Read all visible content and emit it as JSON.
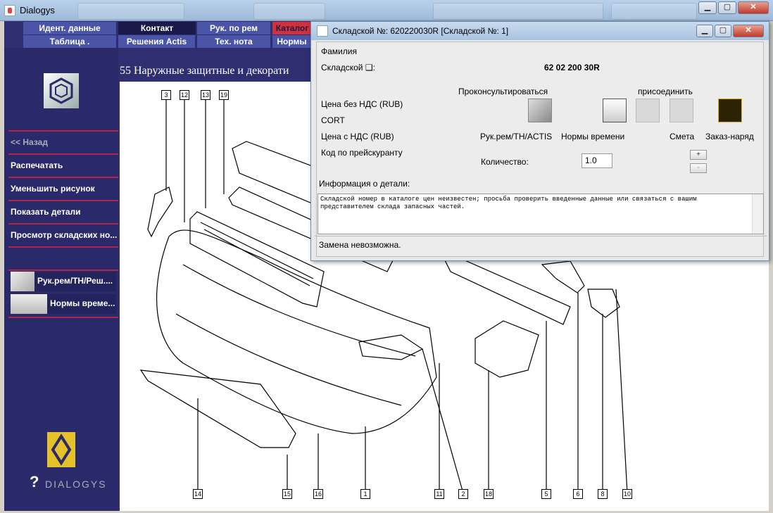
{
  "main_window": {
    "title": "Dialogys",
    "minimize": "▁",
    "maximize": "▢",
    "close": "✕"
  },
  "nav": {
    "row1": [
      "Идент. данные",
      "Контакт",
      "Рук. по рем",
      "Каталог"
    ],
    "row2": [
      "Таблица .",
      "Решения Actis",
      "Тех. нота",
      "Нормы"
    ]
  },
  "sidebar": {
    "back": "<< Назад",
    "items": [
      "Распечатать",
      "Уменьшить рисунок",
      "Показать детали",
      "Просмотр складских но..."
    ],
    "buttons": [
      "Рук.рем/ТН/Реш....",
      "Нормы време..."
    ],
    "logo_text": "DIALOGYS"
  },
  "content": {
    "title": "55 Наружные защитные и декорати"
  },
  "diagram": {
    "callouts_top": [
      "3",
      "12",
      "13",
      "19"
    ],
    "callouts_bottom": [
      "14",
      "15",
      "16",
      "1",
      "11",
      "2",
      "18",
      "5",
      "6",
      "8",
      "10"
    ]
  },
  "dialog": {
    "title": "Складской №: 620220030R [Складской №: 1]",
    "familiya": "Фамилия",
    "skladskoy_label": "Складской ❑:",
    "skladskoy_value": "62 02 200 30R",
    "price_no_vat": "Цена без НДС (RUB)",
    "cort": "CORT",
    "price_vat": "Цена с НДС (RUB)",
    "price_code": "Код по прейскуранту",
    "consult": "Проконсультироваться",
    "attach": "присоединить",
    "repair_label": "Рук.рем/ТН/ACTIS",
    "norms_label": "Нормы времени",
    "estimate_label": "Смета",
    "order_label": "Заказ-наряд",
    "qty_label": "Количество:",
    "qty_value": "1.0",
    "plus": "+",
    "minus": "-",
    "info_label": "Информация о детали:",
    "info_text": "Складской номер в каталоге цен неизвестен; просьба проверить введенные данные или связаться с вашим представителем склада запасных частей.",
    "status": "Замена невозможна."
  }
}
